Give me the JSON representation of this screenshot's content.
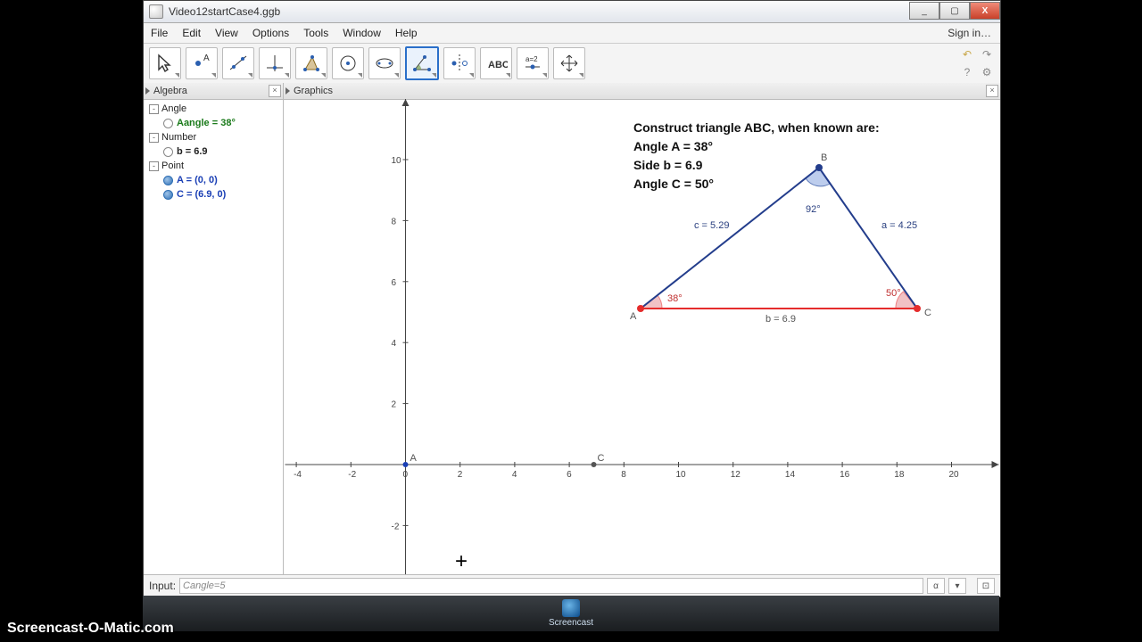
{
  "window": {
    "title": "Video12startCase4.ggb",
    "minimize": "_",
    "maximize": "▢",
    "close": "X"
  },
  "menubar": [
    "File",
    "Edit",
    "View",
    "Options",
    "Tools",
    "Window",
    "Help"
  ],
  "signin": "Sign in…",
  "tools": [
    {
      "name": "move-tool",
      "icon": "pointer"
    },
    {
      "name": "point-tool",
      "icon": "point"
    },
    {
      "name": "line-tool",
      "icon": "line"
    },
    {
      "name": "perpendicular-tool",
      "icon": "perp"
    },
    {
      "name": "polygon-tool",
      "icon": "poly"
    },
    {
      "name": "circle-tool",
      "icon": "circle"
    },
    {
      "name": "conic-tool",
      "icon": "ellipse"
    },
    {
      "name": "angle-tool",
      "icon": "angle",
      "selected": true
    },
    {
      "name": "reflect-tool",
      "icon": "reflect"
    },
    {
      "name": "text-tool",
      "icon": "text"
    },
    {
      "name": "slider-tool",
      "icon": "slider"
    },
    {
      "name": "move-graphics-tool",
      "icon": "pan"
    }
  ],
  "sidebar": {
    "title": "Algebra",
    "categories": [
      {
        "name": "Angle",
        "items": [
          {
            "label": "Aangle = 38°",
            "cls": "valA",
            "filled": false
          }
        ]
      },
      {
        "name": "Number",
        "items": [
          {
            "label": "b = 6.9",
            "cls": "valN",
            "filled": false
          }
        ]
      },
      {
        "name": "Point",
        "items": [
          {
            "label": "A = (0, 0)",
            "cls": "valP",
            "filled": true
          },
          {
            "label": "C = (6.9, 0)",
            "cls": "valP",
            "filled": true
          }
        ]
      }
    ]
  },
  "graphics": {
    "title": "Graphics"
  },
  "problem": {
    "line1": "Construct triangle ABC, when known are:",
    "line2": "Angle A = 38°",
    "line3": "Side b = 6.9",
    "line4": "Angle C = 50°"
  },
  "reference_triangle": {
    "A": "A",
    "B": "B",
    "C": "C",
    "angA": "38°",
    "angB": "92°",
    "angC": "50°",
    "side_a": "a = 4.25",
    "side_b": "b = 6.9",
    "side_c": "c = 5.29"
  },
  "axes": {
    "x_ticks": [
      -4,
      -2,
      0,
      2,
      4,
      6,
      8,
      10,
      12,
      14,
      16,
      18,
      20
    ],
    "y_ticks": [
      -2,
      0,
      2,
      4,
      6,
      8,
      10
    ],
    "points": [
      {
        "name": "A",
        "x": 0,
        "y": 0
      },
      {
        "name": "C",
        "x": 6.9,
        "y": 0
      }
    ]
  },
  "chart_data": {
    "type": "scatter",
    "title": "GeoGebra coordinate plane",
    "xlim": [
      -5,
      21
    ],
    "ylim": [
      -3,
      11
    ],
    "series": [
      {
        "name": "A",
        "x": [
          0
        ],
        "y": [
          0
        ]
      },
      {
        "name": "C",
        "x": [
          6.9
        ],
        "y": [
          0
        ]
      }
    ],
    "annotations": {
      "reference_triangle": {
        "vertices": {
          "A": "38°",
          "B": "92°",
          "C": "50°"
        },
        "sides": {
          "a": 4.25,
          "b": 6.9,
          "c": 5.29
        }
      }
    }
  },
  "input": {
    "label": "Input:",
    "value": "Cangle=5"
  },
  "taskbar": {
    "item": "Screencast"
  },
  "watermark": "Screencast-O-Matic.com"
}
